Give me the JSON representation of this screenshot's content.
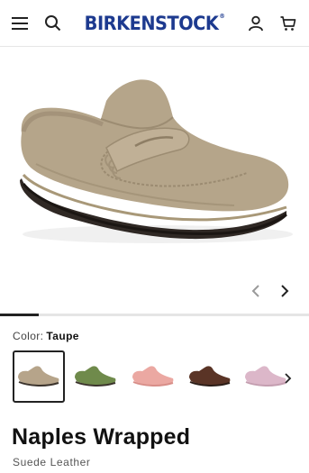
{
  "header": {
    "brand": "BIRKENSTOCK",
    "brand_mark": "®",
    "icons": {
      "menu": "hamburger-menu-icon",
      "search": "search-icon",
      "account": "user-icon",
      "cart": "cart-icon"
    }
  },
  "gallery": {
    "image": "taupe-suede-clog-product-photo",
    "progress": 0.125,
    "prev_icon": "chevron-left-icon",
    "next_icon": "chevron-right-icon"
  },
  "colors": {
    "label": "Color:",
    "selected": "Taupe",
    "swatches": [
      {
        "name": "Taupe",
        "hex": "#b6a48a",
        "selected": true
      },
      {
        "name": "Green",
        "hex": "#6f8a4b",
        "selected": false
      },
      {
        "name": "Pink",
        "hex": "#eba8a2",
        "selected": false
      },
      {
        "name": "Brown",
        "hex": "#5a3426",
        "selected": false
      },
      {
        "name": "Lilac",
        "hex": "#dcb7c9",
        "selected": false
      }
    ],
    "next_icon": "chevron-right-icon"
  },
  "product": {
    "name": "Naples Wrapped",
    "material": "Suede Leather"
  },
  "palette": {
    "brand": "#1d3a8f",
    "text": "#111111",
    "muted": "#555555"
  }
}
